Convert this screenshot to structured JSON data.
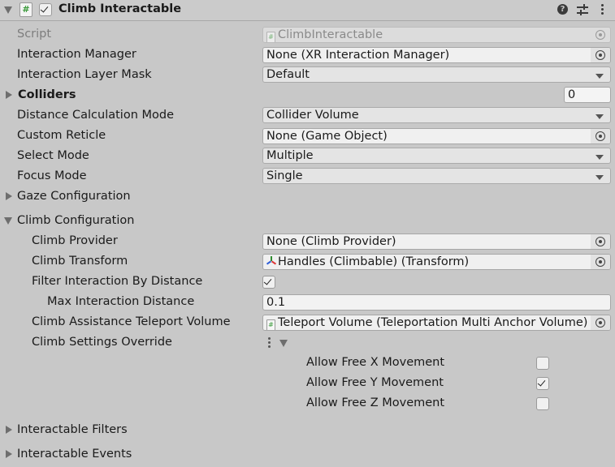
{
  "header": {
    "title": "Climb Interactable",
    "enabled": true,
    "script_icon": "script-icon",
    "help_icon": "help-icon",
    "presets_icon": "presets-icon",
    "menu_icon": "kebab-menu-icon"
  },
  "fields": {
    "script": {
      "label": "Script",
      "value": "ClimbInteractable"
    },
    "interaction_manager": {
      "label": "Interaction Manager",
      "value": "None (XR Interaction Manager)"
    },
    "interaction_layer_mask": {
      "label": "Interaction Layer Mask",
      "value": "Default"
    },
    "colliders": {
      "label": "Colliders",
      "value": "0"
    },
    "distance_calculation_mode": {
      "label": "Distance Calculation Mode",
      "value": "Collider Volume"
    },
    "custom_reticle": {
      "label": "Custom Reticle",
      "value": "None (Game Object)"
    },
    "select_mode": {
      "label": "Select Mode",
      "value": "Multiple"
    },
    "focus_mode": {
      "label": "Focus Mode",
      "value": "Single"
    },
    "gaze_configuration": {
      "label": "Gaze Configuration",
      "expanded": false
    },
    "climb_configuration": {
      "label": "Climb Configuration",
      "expanded": true
    }
  },
  "climb": {
    "climb_provider": {
      "label": "Climb Provider",
      "value": "None (Climb Provider)"
    },
    "climb_transform": {
      "label": "Climb Transform",
      "value": "Handles (Climbable) (Transform)"
    },
    "filter_by_distance": {
      "label": "Filter Interaction By Distance",
      "checked": true
    },
    "max_interaction_distance": {
      "label": "Max Interaction Distance",
      "value": "0.1"
    },
    "teleport_volume": {
      "label": "Climb Assistance Teleport Volume",
      "value": "Teleport Volume (Teleportation Multi Anchor Volume)"
    },
    "settings_override": {
      "label": "Climb Settings Override"
    },
    "allow_free_x": {
      "label": "Allow Free X Movement",
      "checked": false
    },
    "allow_free_y": {
      "label": "Allow Free Y Movement",
      "checked": true
    },
    "allow_free_z": {
      "label": "Allow Free Z Movement",
      "checked": false
    }
  },
  "foldouts": {
    "interactable_filters": {
      "label": "Interactable Filters",
      "expanded": false
    },
    "interactable_events": {
      "label": "Interactable Events",
      "expanded": false
    }
  }
}
